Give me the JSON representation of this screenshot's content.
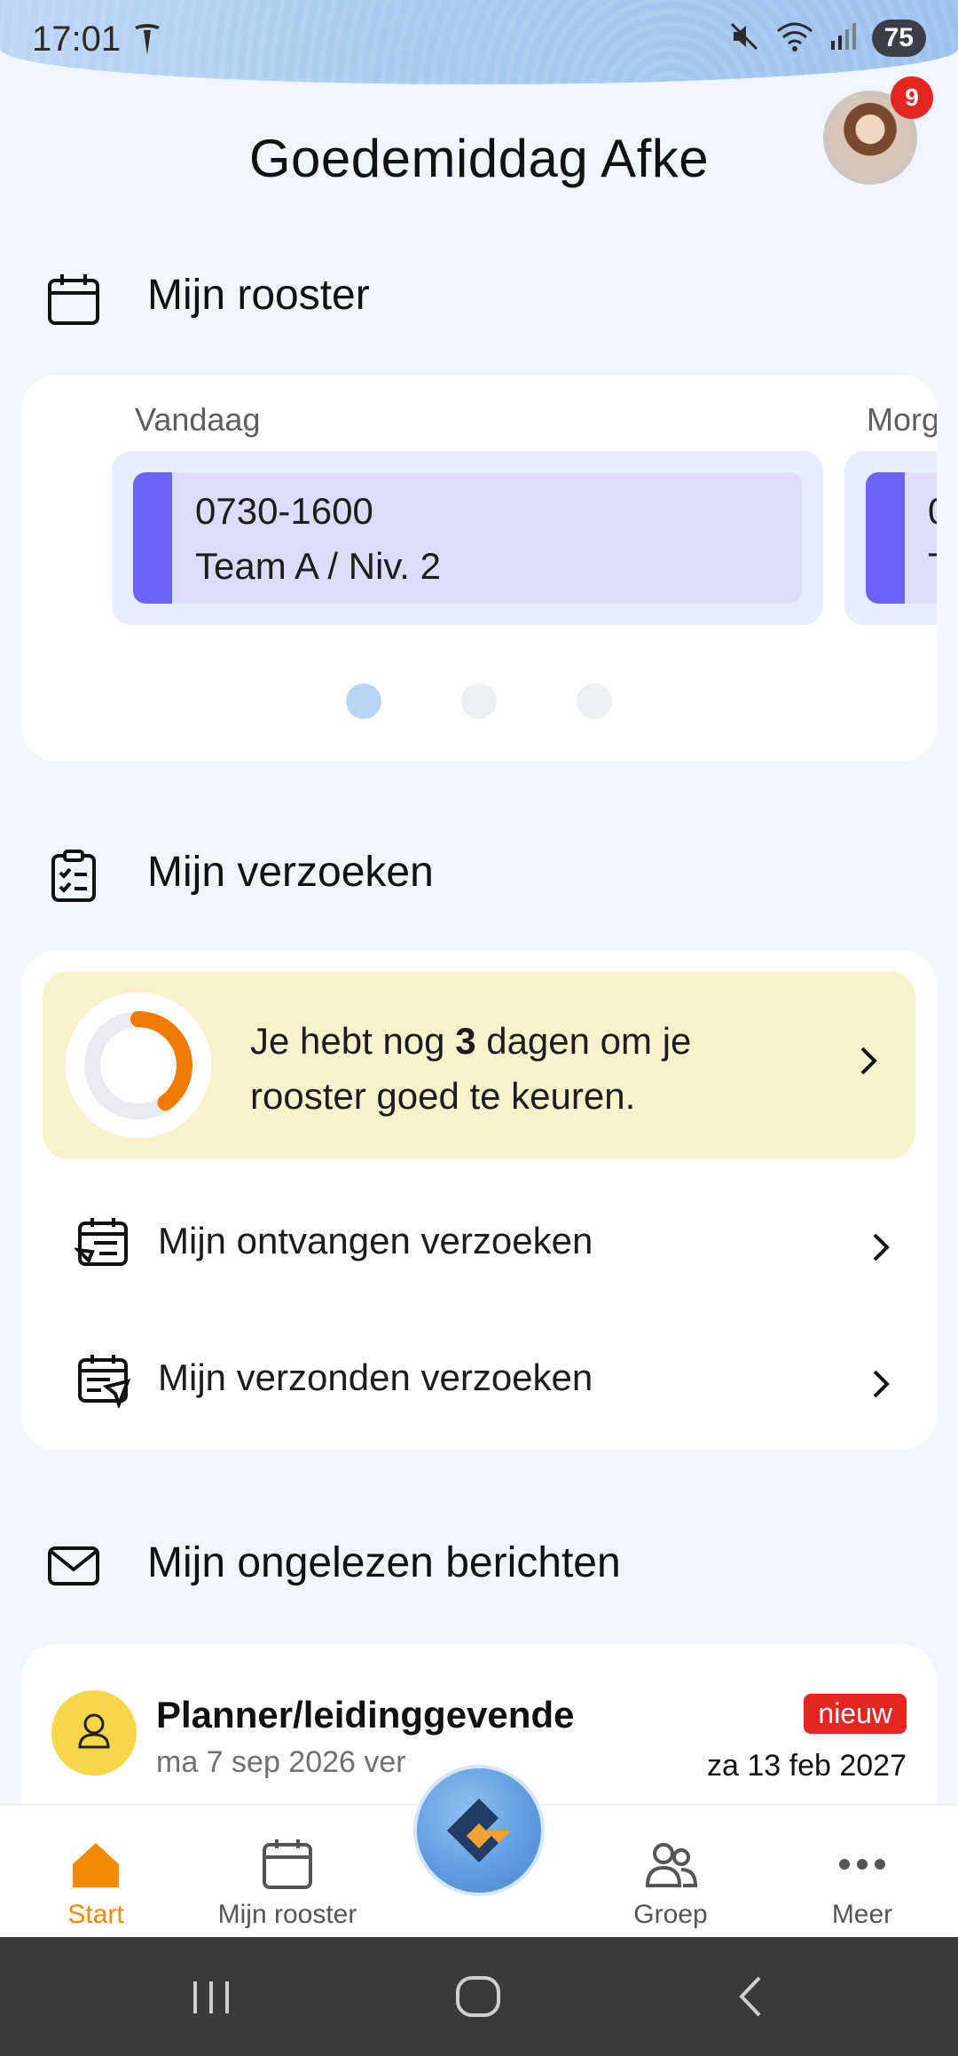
{
  "status_bar": {
    "time": "17:01",
    "battery": "75"
  },
  "header": {
    "greeting": "Goedemiddag Afke",
    "notification_count": "9"
  },
  "roster": {
    "title": "Mijn rooster",
    "days": [
      {
        "label": "Vandaag",
        "time": "0730-1600",
        "team": "Team A / Niv. 2"
      },
      {
        "label": "Morg",
        "time": "0",
        "team": "T"
      }
    ],
    "page_index": 0,
    "page_count": 3
  },
  "requests": {
    "title": "Mijn verzoeken",
    "approve_pre": "Je hebt nog ",
    "approve_days": "3",
    "approve_post": " dagen om je rooster goed te keuren.",
    "approve_progress": 0.4,
    "items": [
      {
        "label": "Mijn ontvangen verzoeken",
        "icon": "received-requests-icon"
      },
      {
        "label": "Mijn verzonden verzoeken",
        "icon": "sent-requests-icon"
      }
    ]
  },
  "messages": {
    "title": "Mijn ongelezen berichten",
    "first": {
      "sender": "Planner/leidinggevende",
      "preview": "ma 7 sep 2026 ver",
      "badge": "nieuw",
      "date": "za 13 feb 2027"
    }
  },
  "bottom_nav": {
    "items": [
      {
        "label": "Start",
        "icon": "home-icon",
        "active": true
      },
      {
        "label": "Mijn rooster",
        "icon": "calendar-icon",
        "active": false
      },
      {
        "label": "Groep",
        "icon": "group-icon",
        "active": false
      },
      {
        "label": "Meer",
        "icon": "more-icon",
        "active": false
      }
    ]
  },
  "colors": {
    "accent": "#f08a00",
    "shift_bar": "#6a63f5",
    "badge": "#e52521"
  }
}
